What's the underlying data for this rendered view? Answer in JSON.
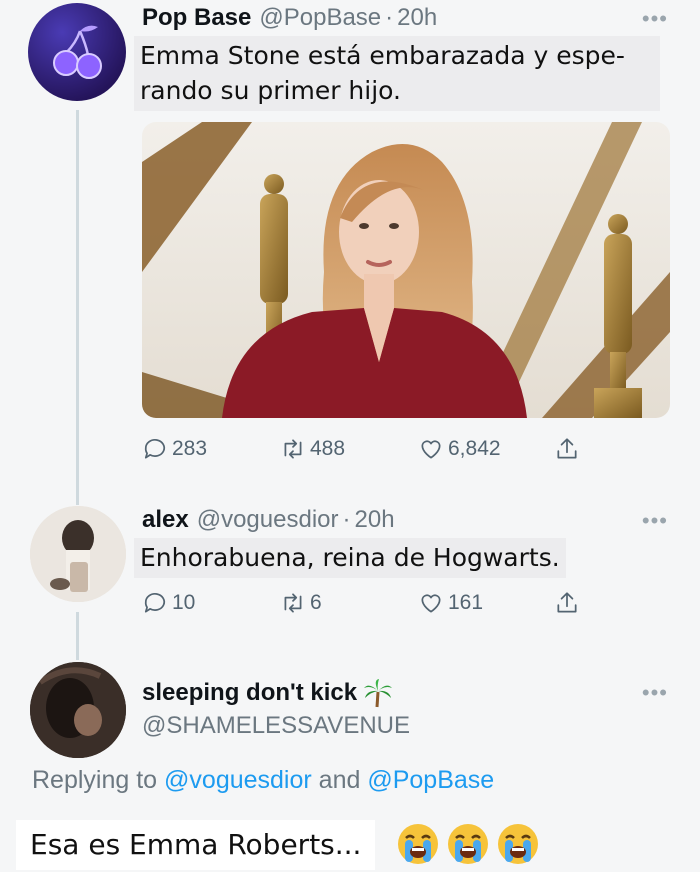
{
  "tweets": [
    {
      "name": "Pop Base",
      "handle": "@PopBase",
      "time": "20h",
      "text_line1": "Emma Stone está embarazada y espe-",
      "text_line2": "rando su primer hijo.",
      "stats": {
        "replies": "283",
        "retweets": "488",
        "likes": "6,842"
      }
    },
    {
      "name": "alex",
      "handle": "@voguesdior",
      "time": "20h",
      "text": "Enhorabuena, reina de Hogwarts.",
      "stats": {
        "replies": "10",
        "retweets": "6",
        "likes": "161"
      }
    },
    {
      "name": "sleeping don't kick",
      "handle": "@SHAMELESSAVENUE",
      "name_emoji": "palm-tree-icon",
      "replying_prefix": "Replying to",
      "replying_user1": "@voguesdior",
      "replying_and": "and",
      "replying_user2": "@PopBase",
      "text": "Esa es Emma Roberts...",
      "text_emojis": [
        "loudly-crying-face-icon",
        "loudly-crying-face-icon",
        "loudly-crying-face-icon"
      ]
    }
  ],
  "separator": "·",
  "colors": {
    "link": "#1d9bf0",
    "muted": "#6b7780",
    "dress": "#8b1a26"
  }
}
